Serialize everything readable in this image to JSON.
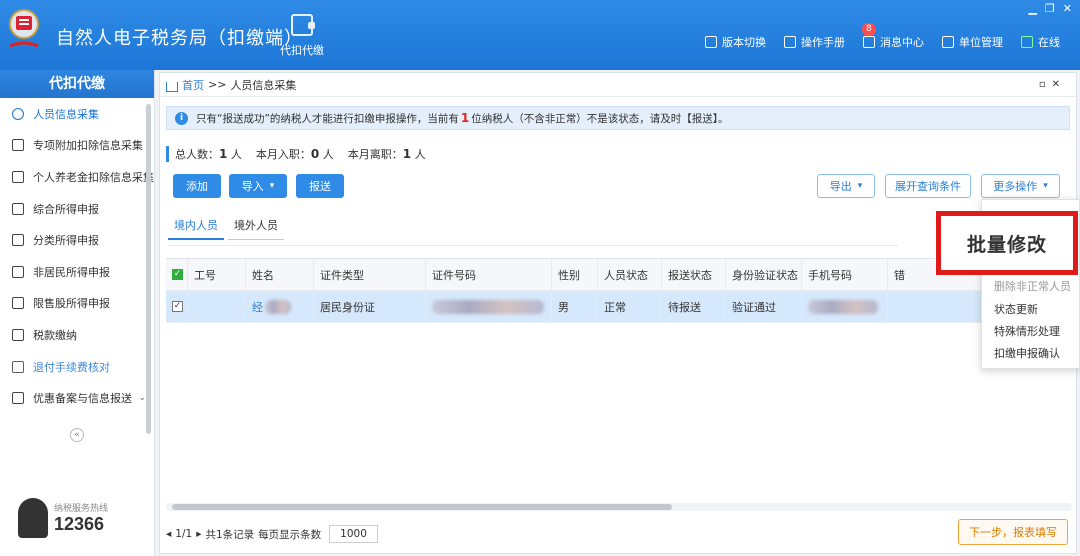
{
  "app": {
    "title": "自然人电子税务局（扣缴端）",
    "module_label": "代扣代缴",
    "actions": [
      {
        "label": "版本切换",
        "icon": "switch-icon"
      },
      {
        "label": "操作手册",
        "icon": "manual-icon"
      },
      {
        "label": "消息中心",
        "icon": "message-icon",
        "badge": "8"
      },
      {
        "label": "单位管理",
        "icon": "building-icon"
      },
      {
        "label": "在线",
        "icon": "online-icon"
      }
    ]
  },
  "sidebar": {
    "header": "代扣代缴",
    "items": [
      {
        "label": "人员信息采集",
        "icon": "person-icon",
        "state": "active"
      },
      {
        "label": "专项附加扣除信息采集",
        "icon": "list-icon"
      },
      {
        "label": "个人养老金扣除信息采集",
        "icon": "id-card-icon"
      },
      {
        "label": "综合所得申报",
        "icon": "layers-icon"
      },
      {
        "label": "分类所得申报",
        "icon": "pie-icon"
      },
      {
        "label": "非居民所得申报",
        "icon": "person-alt-icon"
      },
      {
        "label": "限售股所得申报",
        "icon": "bar-chart-icon"
      },
      {
        "label": "税款缴纳",
        "icon": "folder-icon"
      },
      {
        "label": "退付手续费核对",
        "icon": "document-icon",
        "state": "faded"
      },
      {
        "label": "优惠备案与信息报送",
        "icon": "document-alt-icon",
        "expandable": true
      }
    ],
    "collapse_symbol": "«",
    "hotline_label": "纳税服务热线",
    "hotline_number": "12366"
  },
  "breadcrumb": {
    "home": "首页",
    "separator": ">>",
    "current": "人员信息采集"
  },
  "notice": {
    "prefix": "只有“报送成功”的纳税人才能进行扣缴申报操作，当前有",
    "count": "1",
    "suffix": "位纳税人（不含非正常）不是该状态，请及时【报送】。"
  },
  "stats": {
    "total_label": "总人数：",
    "total": "1",
    "join_label": "本月入职：",
    "join": "0",
    "leave_label": "本月离职：",
    "leave": "1",
    "unit": "人"
  },
  "toolbar": {
    "add": "添加",
    "import": "导入",
    "submit": "报送",
    "export": "导出",
    "expand_query": "展开查询条件",
    "more_ops": "更多操作"
  },
  "tabs": {
    "domestic": "境内人员",
    "overseas": "境外人员"
  },
  "table": {
    "columns": [
      "工号",
      "姓名",
      "证件类型",
      "证件号码",
      "性别",
      "人员状态",
      "报送状态",
      "身份验证状态",
      "手机号码",
      "错"
    ],
    "rows": [
      {
        "emp_id": "",
        "name": "经",
        "id_type": "居民身份证",
        "gender": "男",
        "status": "正常",
        "submit_status": "待报送",
        "verify_status": "验证通过"
      }
    ]
  },
  "pager": {
    "page": "1/1",
    "records": "共1条记录",
    "per_page_label": "每页显示条数",
    "per_page": "1000"
  },
  "next_button": "下一步，报表填写",
  "dropdown": {
    "items": [
      "删除非正常人员",
      "状态更新",
      "特殊情形处理",
      "扣缴申报确认"
    ],
    "highlight": "批量修改"
  },
  "colors": {
    "primary": "#2f8be6",
    "callout": "#e01919",
    "next": "#f2a33a"
  }
}
